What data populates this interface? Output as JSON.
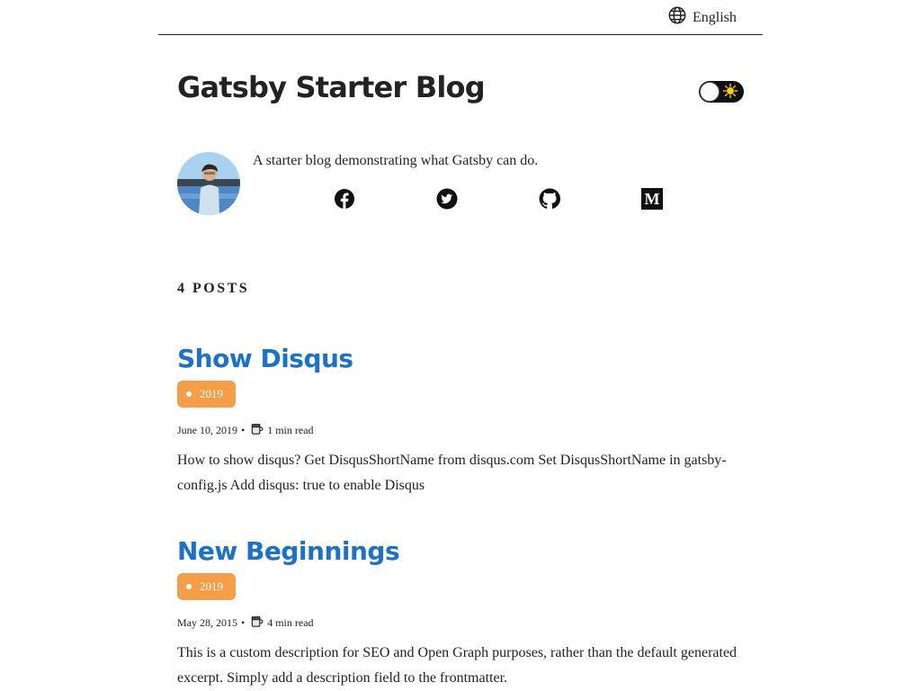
{
  "header": {
    "language_label": "English"
  },
  "site": {
    "title": "Gatsby Starter Blog",
    "bio": "A starter blog demonstrating what Gatsby can do."
  },
  "theme_toggle": {
    "mode": "light",
    "icon": "sun-icon"
  },
  "social": [
    {
      "name": "facebook",
      "icon": "facebook-icon"
    },
    {
      "name": "twitter",
      "icon": "twitter-icon"
    },
    {
      "name": "github",
      "icon": "github-icon"
    },
    {
      "name": "medium",
      "icon": "medium-icon"
    }
  ],
  "posts_count": "4 POSTS",
  "posts": [
    {
      "title": "Show Disqus",
      "tag": "2019",
      "date": "June 10, 2019",
      "separator": "•",
      "read_time": "1 min read",
      "excerpt": "How to show disqus? Get DisqusShortName from disqus.com Set DisqusShortName in gatsby-config.js Add disqus: true to enable Disqus"
    },
    {
      "title": "New Beginnings",
      "tag": "2019",
      "date": "May 28, 2015",
      "separator": "•",
      "read_time": "4 min read",
      "excerpt": "This is a custom description for SEO and Open Graph purposes, rather than the default generated excerpt. Simply add a description field to the frontmatter."
    }
  ],
  "colors": {
    "link": "#1a73c8",
    "tag_bg": "#f59e47",
    "text": "#222222"
  }
}
